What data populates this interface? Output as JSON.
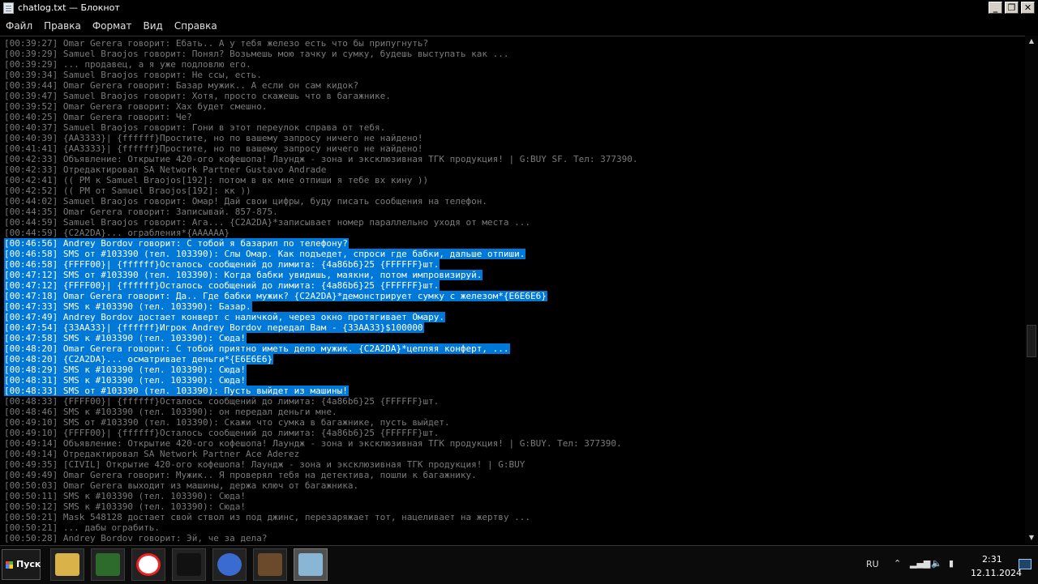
{
  "window": {
    "title": "chatlog.txt — Блокнот",
    "minimize_glyph": "_",
    "maximize_glyph": "❐",
    "close_glyph": "✕"
  },
  "menu": [
    "Файл",
    "Правка",
    "Формат",
    "Вид",
    "Справка"
  ],
  "log": [
    {
      "text": "[00:39:27] Omar Gerera говорит: Ебать.. А у тебя железо есть что бы припугнуть?",
      "selected": false
    },
    {
      "text": "[00:39:29] Samuel Braojos говорит: Понял? Возьмешь мою тачку и сумку, будешь выступать как ...",
      "selected": false
    },
    {
      "text": "[00:39:29] ... продавец, а я уже подловлю его.",
      "selected": false
    },
    {
      "text": "[00:39:34] Samuel Braojos говорит: Не ссы, есть.",
      "selected": false
    },
    {
      "text": "[00:39:44] Omar Gerera говорит: Базар мужик.. А если он сам кидок?",
      "selected": false
    },
    {
      "text": "[00:39:47] Samuel Braojos говорит: Хотя, просто скажешь что в багажнике.",
      "selected": false
    },
    {
      "text": "[00:39:52] Omar Gerera говорит: Хах будет смешно.",
      "selected": false
    },
    {
      "text": "[00:40:25] Omar Gerera говорит: Че?",
      "selected": false
    },
    {
      "text": "[00:40:37] Samuel Braojos говорит: Гони в этот переулок справа от тебя.",
      "selected": false
    },
    {
      "text": "[00:40:39] {AA3333}| {ffffff}Простите, но по вашему запросу ничего не найдено!",
      "selected": false
    },
    {
      "text": "[00:41:41] {AA3333}| {ffffff}Простите, но по вашему запросу ничего не найдено!",
      "selected": false
    },
    {
      "text": "[00:42:33] Объявление: Открытие 420-ого кофешопа! Лаундж - зона и эксклюзивная ТГК продукция! | G:BUY SF. Тел: 377390.",
      "selected": false
    },
    {
      "text": "[00:42:33] Отредактировал SA Network Partner Gustavo Andrade",
      "selected": false
    },
    {
      "text": "[00:42:41] (( PM к Samuel Braojos[192]: потом в вк мне отпиши я тебе вх кину ))",
      "selected": false
    },
    {
      "text": "[00:42:52] (( PM от Samuel Braojos[192]: кк ))",
      "selected": false
    },
    {
      "text": "[00:44:02] Samuel Braojos говорит: Омар! Дай свои цифры, буду писать сообщения на телефон.",
      "selected": false
    },
    {
      "text": "[00:44:35] Omar Gerera говорит: Записывай. 857-875.",
      "selected": false
    },
    {
      "text": "[00:44:59] Samuel Braojos говорит: Ага... {C2A2DA}*записывает номер параллельно уходя от места ...",
      "selected": false
    },
    {
      "text": "[00:44:59] {C2A2DA}... ограбления*{AAAAAA}",
      "selected": false
    },
    {
      "text": "[00:46:56] Andrey Bordov говорит: С тобой я базарил по телефону?",
      "selected": true
    },
    {
      "text": "[00:46:58] SMS от #103390 (тел. 103390): Слы Омар. Как подъедет, спроси где бабки, дальше отпиши.",
      "selected": true
    },
    {
      "text": "[00:46:58] {FFFF00}| {ffffff}Осталось сообщений до лимита: {4a86b6}25 {FFFFFF}шт.",
      "selected": true
    },
    {
      "text": "[00:47:12] SMS от #103390 (тел. 103390): Когда бабки увидишь, маякни, потом импровизируй.",
      "selected": true
    },
    {
      "text": "[00:47:12] {FFFF00}| {ffffff}Осталось сообщений до лимита: {4a86b6}25 {FFFFFF}шт.",
      "selected": true
    },
    {
      "text": "[00:47:18] Omar Gerera говорит: Да.. Где бабки мужик? {C2A2DA}*демонстрирует сумку с железом*{E6E6E6}",
      "selected": true
    },
    {
      "text": "[00:47:33] SMS к #103390 (тел. 103390): Базар.",
      "selected": true
    },
    {
      "text": "[00:47:49] Andrey Bordov достает конверт с наличкой, через окно протягивает Омару.",
      "selected": true
    },
    {
      "text": "[00:47:54] {33AA33}| {ffffff}Игрок Andrey Bordov передал Вам - {33AA33}$100000",
      "selected": true
    },
    {
      "text": "[00:47:58] SMS к #103390 (тел. 103390): Сюда!",
      "selected": true
    },
    {
      "text": "[00:48:20] Omar Gerera говорит: С тобой приятно иметь дело мужик. {C2A2DA}*цепляя конферт, ...",
      "selected": true
    },
    {
      "text": "[00:48:20] {C2A2DA}... осматривает деньги*{E6E6E6}",
      "selected": true
    },
    {
      "text": "[00:48:29] SMS к #103390 (тел. 103390): Сюда!",
      "selected": true
    },
    {
      "text": "[00:48:31] SMS к #103390 (тел. 103390): Сюда!",
      "selected": true
    },
    {
      "text": "[00:48:33] SMS от #103390 (тел. 103390): Пусть выйдет из машины!",
      "selected": true
    },
    {
      "text": "[00:48:33] {FFFF00}| {ffffff}Осталось сообщений до лимита: {4a86b6}25 {FFFFFF}шт.",
      "selected": false
    },
    {
      "text": "[00:48:46] SMS к #103390 (тел. 103390): он передал деньги мне.",
      "selected": false
    },
    {
      "text": "[00:49:10] SMS от #103390 (тел. 103390): Скажи что сумка в багажнике, пусть выйдет.",
      "selected": false
    },
    {
      "text": "[00:49:10] {FFFF00}| {ffffff}Осталось сообщений до лимита: {4a86b6}25 {FFFFFF}шт.",
      "selected": false
    },
    {
      "text": "[00:49:14] Объявление: Открытие 420-ого кофешопа! Лаундж - зона и эксклюзивная ТГК продукция! | G:BUY. Тел: 377390.",
      "selected": false
    },
    {
      "text": "[00:49:14] Отредактировал SA Network Partner Ace Aderez",
      "selected": false
    },
    {
      "text": "[00:49:35] [CIVIL] Открытие 420-ого кофешопа! Лаундж - зона и эксклюзивная ТГК продукция! | G:BUY",
      "selected": false
    },
    {
      "text": "[00:49:49] Omar Gerera говорит: Мужик.. Я проверял тебя на детектива, пошли к багажнику.",
      "selected": false
    },
    {
      "text": "[00:50:03] Omar Gerera выходит из машины, держа ключ от багажника.",
      "selected": false
    },
    {
      "text": "[00:50:11] SMS к #103390 (тел. 103390): Сюда!",
      "selected": false
    },
    {
      "text": "[00:50:12] SMS к #103390 (тел. 103390): Сюда!",
      "selected": false
    },
    {
      "text": "[00:50:21] Mask 548128 достает свой ствол из под джинс, перезаряжает тот, нацеливает на жертву ...",
      "selected": false
    },
    {
      "text": "[00:50:21] ... дабы ограбить.",
      "selected": false
    },
    {
      "text": "[00:50:28] Andrey Bordov говорит: Эй, че за дела?",
      "selected": false
    }
  ],
  "scrollbar": {
    "up_glyph": "▲",
    "down_glyph": "▼"
  },
  "taskbar": {
    "start_label": "Пуск",
    "apps": [
      {
        "name": "file-explorer",
        "color": "#d9b24a"
      },
      {
        "name": "task-manager",
        "color": "#2d6b2d"
      },
      {
        "name": "yandex-browser",
        "color": "#e22"
      },
      {
        "name": "command-prompt",
        "color": "#111"
      },
      {
        "name": "cheat-engine",
        "color": "#3a6bd0"
      },
      {
        "name": "gta-san-andreas",
        "color": "#6b4a2b"
      },
      {
        "name": "notepad",
        "color": "#8ab6d6"
      }
    ],
    "language": "RU",
    "time": "2:31",
    "date": "12.11.2024"
  }
}
